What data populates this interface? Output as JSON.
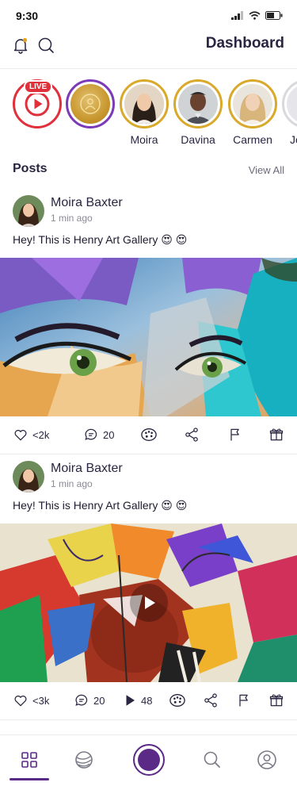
{
  "status": {
    "time": "9:30"
  },
  "header": {
    "title": "Dashboard"
  },
  "stories": [
    {
      "kind": "live",
      "badge": "LIVE",
      "name": ""
    },
    {
      "kind": "badge",
      "name": ""
    },
    {
      "kind": "user",
      "name": "Moira"
    },
    {
      "kind": "user",
      "name": "Davina"
    },
    {
      "kind": "user",
      "name": "Carmen"
    },
    {
      "kind": "user",
      "name": "Jo"
    }
  ],
  "posts_section": {
    "title": "Posts",
    "view_all": "View All"
  },
  "posts": [
    {
      "author": "Moira Baxter",
      "time": "1 min ago",
      "text": "Hey! This is Henry Art Gallery 😍 😍",
      "likes": "<2k",
      "comments": "20",
      "plays": ""
    },
    {
      "author": "Moira Baxter",
      "time": "1 min ago",
      "text": "Hey! This is Henry Art Gallery 😍 😍",
      "likes": "<3k",
      "comments": "20",
      "plays": "48"
    }
  ],
  "colors": {
    "accent": "#5a2a86",
    "gold": "#d9a92b",
    "live": "#e0303b"
  },
  "icons": [
    "bell-icon",
    "search-icon",
    "heart-icon",
    "comment-icon",
    "palette-icon",
    "share-icon",
    "flag-icon",
    "gift-icon",
    "play-icon",
    "grid-icon",
    "globe-icon",
    "profile-icon"
  ]
}
